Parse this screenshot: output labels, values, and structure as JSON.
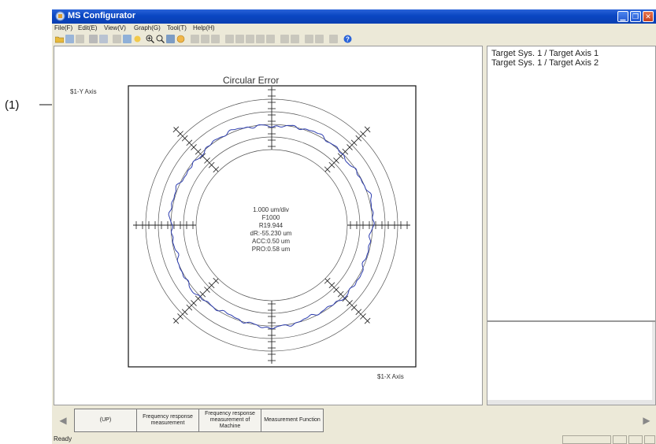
{
  "callout": {
    "label": "(1)"
  },
  "window": {
    "title": "MS Configurator",
    "icon": "app-icon",
    "controls": [
      "minimize-icon",
      "maximize-icon",
      "close-icon"
    ]
  },
  "menu": [
    "File(F)",
    "Edit(E)",
    "View(V)",
    "Graph(G)",
    "Tool(T)",
    "Help(H)"
  ],
  "toolbar": {
    "icons": [
      "open-folder-icon",
      "save-icon",
      "save-disabled-icon",
      "print-icon",
      "print-preview-icon",
      "disabled-icon",
      "graph-settings-icon",
      "measure-icon",
      "zoom-in-icon",
      "zoom-reset-icon",
      "zoom-fit-icon",
      "color-icon",
      "disabled-icon",
      "disabled-icon",
      "disabled-icon",
      "disabled-icon",
      "disabled-icon",
      "disabled-icon",
      "disabled-icon",
      "disabled-icon",
      "disabled-icon",
      "disabled-icon",
      "disabled-icon",
      "disabled-icon",
      "disabled-icon",
      "disabled-icon",
      "help-icon"
    ]
  },
  "graph": {
    "title": "Circular Error",
    "y_axis_label": "$1-Y Axis",
    "x_axis_label": "$1-X Axis",
    "info": [
      "1.000 um/div",
      "F1000",
      "R19.944",
      "dR:-55.230 um",
      "ACC:0.50 um",
      "PRO:0.58 um"
    ]
  },
  "chart_data": {
    "type": "scatter",
    "title": "Circular Error",
    "xlabel": "$1-X Axis",
    "ylabel": "$1-Y Axis",
    "scale": "1.000 um/div",
    "feedrate": "F1000",
    "radius": "R19.944",
    "dR": "-55.230 um",
    "accuracy": "0.50 um",
    "profile": "0.58 um",
    "series": [
      {
        "name": "",
        "color": "#2f3fb0"
      }
    ]
  },
  "axis_list": [
    "Target Sys. 1 / Target Axis 1",
    "Target Sys. 1 / Target Axis 2"
  ],
  "function_keys": [
    "(UP)",
    "Frequency response measurement",
    "Frequency response measurement of Machine",
    "Measurement Function"
  ],
  "status": {
    "text": "Ready"
  },
  "colors": {
    "titlebar": "#0a46c2",
    "trace": "#2f3fb0",
    "callout": "#111111"
  }
}
